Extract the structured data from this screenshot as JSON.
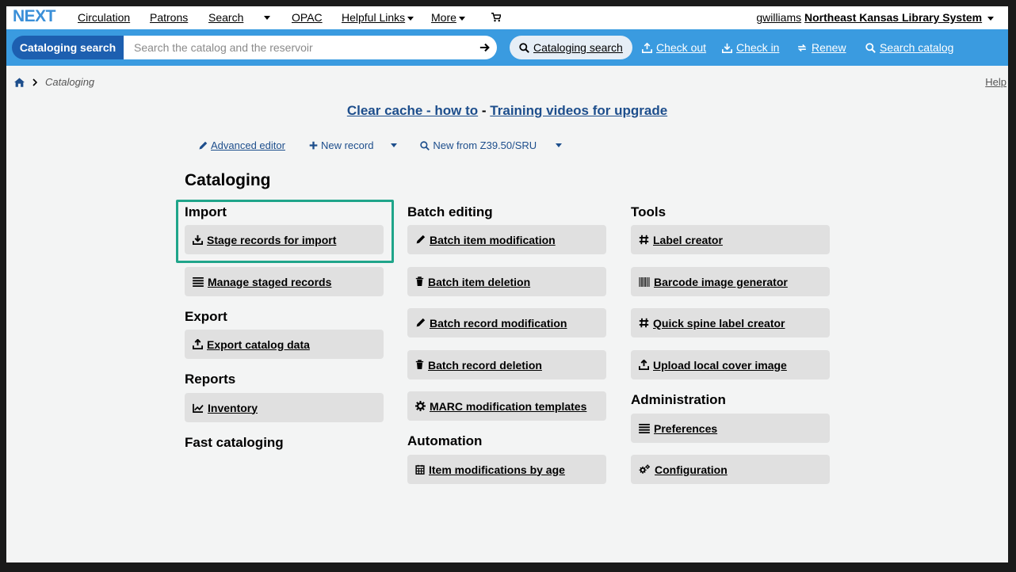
{
  "nav": {
    "logo": "NEXT",
    "items": [
      "Circulation",
      "Patrons",
      "Search",
      "OPAC",
      "Helpful Links",
      "More"
    ],
    "user": "gwilliams",
    "library": "Northeast Kansas Library System"
  },
  "searchbar": {
    "mode_label": "Cataloging search",
    "placeholder": "Search the catalog and the reservoir",
    "tools": [
      "Cataloging search",
      "Check out",
      "Check in",
      "Renew",
      "Search catalog"
    ]
  },
  "breadcrumb": {
    "current": "Cataloging",
    "help": "Help"
  },
  "promo": {
    "link1": "Clear cache - how to",
    "separator": "-",
    "link2": "Training videos for upgrade"
  },
  "toolbar": {
    "advanced_editor": "Advanced editor",
    "new_record": "New record",
    "new_from_z3950": "New from Z39.50/SRU"
  },
  "page": {
    "title": "Cataloging"
  },
  "sections": {
    "import": {
      "title": "Import",
      "items": [
        "Stage records for import",
        "Manage staged records"
      ]
    },
    "export": {
      "title": "Export",
      "items": [
        "Export catalog data"
      ]
    },
    "reports": {
      "title": "Reports",
      "items": [
        "Inventory"
      ]
    },
    "fast": {
      "title": "Fast cataloging"
    },
    "batch": {
      "title": "Batch editing",
      "items": [
        "Batch item modification",
        "Batch item deletion",
        "Batch record modification",
        "Batch record deletion",
        "MARC modification templates"
      ]
    },
    "automation": {
      "title": "Automation",
      "items": [
        "Item modifications by age"
      ]
    },
    "tools": {
      "title": "Tools",
      "items": [
        "Label creator",
        "Barcode image generator",
        "Quick spine label creator",
        "Upload local cover image"
      ]
    },
    "admin": {
      "title": "Administration",
      "items": [
        "Preferences",
        "Configuration"
      ]
    }
  },
  "colors": {
    "accent_bar": "#3a9be0",
    "highlight": "#1fa58a",
    "link": "#1d4e8c"
  }
}
